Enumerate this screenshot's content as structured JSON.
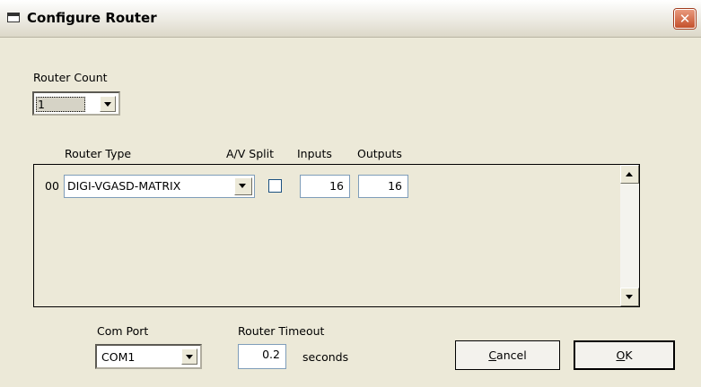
{
  "window": {
    "title": "Configure Router",
    "close_icon": "close-icon"
  },
  "router_count": {
    "label": "Router Count",
    "value": "1"
  },
  "router_table": {
    "columns": {
      "type": "Router Type",
      "av_split": "A/V Split",
      "inputs": "Inputs",
      "outputs": "Outputs"
    },
    "rows": [
      {
        "index": "00",
        "type": "DIGI-VGASD-MATRIX",
        "av_split": false,
        "inputs": "16",
        "outputs": "16"
      }
    ]
  },
  "com_port": {
    "label": "Com Port",
    "value": "COM1"
  },
  "router_timeout": {
    "label": "Router Timeout",
    "value": "0.2",
    "unit": "seconds"
  },
  "buttons": {
    "cancel": {
      "mnemonic": "C",
      "rest": "ancel"
    },
    "ok": {
      "mnemonic": "O",
      "rest": "K"
    }
  }
}
